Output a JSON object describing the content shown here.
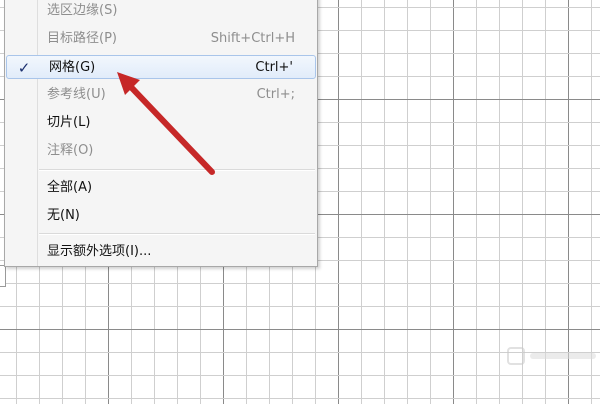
{
  "view_show_menu": {
    "items": [
      {
        "label": "选区边缘(S)",
        "shortcut": "",
        "enabled": false,
        "checked": false
      },
      {
        "label": "目标路径(P)",
        "shortcut": "Shift+Ctrl+H",
        "enabled": false,
        "checked": false
      },
      {
        "label": "网格(G)",
        "shortcut": "Ctrl+'",
        "enabled": true,
        "checked": true,
        "highlighted": true
      },
      {
        "label": "参考线(U)",
        "shortcut": "Ctrl+;",
        "enabled": false,
        "checked": false
      },
      {
        "label": "切片(L)",
        "shortcut": "",
        "enabled": true,
        "checked": false
      },
      {
        "label": "注释(O)",
        "shortcut": "",
        "enabled": false,
        "checked": false
      },
      {
        "label": "全部(A)",
        "shortcut": "",
        "enabled": true,
        "checked": false
      },
      {
        "label": "无(N)",
        "shortcut": "",
        "enabled": true,
        "checked": false
      },
      {
        "label": "显示额外选项(I)...",
        "shortcut": "",
        "enabled": true,
        "checked": false
      }
    ],
    "check_glyph": "✓"
  },
  "canvas": {
    "background": "#ffffff",
    "grid_color": "#8a8a8a",
    "subgrid_color": "#cfcfcf"
  },
  "annotation": {
    "arrow_color": "#c62828",
    "points_to": "网格(G)"
  }
}
